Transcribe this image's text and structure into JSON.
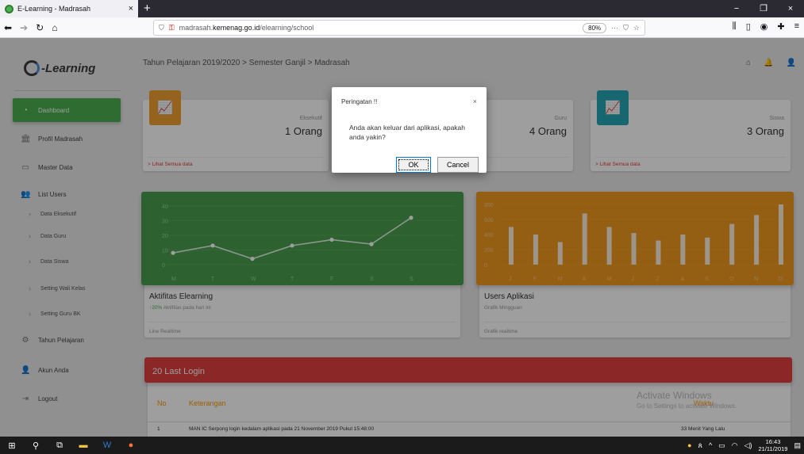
{
  "browser": {
    "tab_title": "E-Learning - Madrasah",
    "tab_close": "×",
    "new_tab": "+",
    "url_plain": "madrasah.",
    "url_domain": "kemenag.go.id",
    "url_path": "/elearning/school",
    "zoom": "80%",
    "win_minimize": "−",
    "win_maximize": "❐",
    "win_close": "×"
  },
  "app": {
    "logo_text": "-Learning",
    "breadcrumb": "Tahun Pelajaran 2019/2020 > Semester Ganjil > Madrasah",
    "menu": [
      {
        "label": "Dashboard",
        "icon": "dashboard-icon"
      },
      {
        "label": "Profil Madrasah",
        "icon": "bank-icon"
      },
      {
        "label": "Master Data",
        "icon": "monitor-icon"
      },
      {
        "label": "List Users",
        "icon": "users-icon"
      },
      {
        "label": "Tahun Pelajaran",
        "icon": "gear-icon"
      },
      {
        "label": "Akun Anda",
        "icon": "user-icon"
      },
      {
        "label": "Logout",
        "icon": "logout-icon"
      }
    ],
    "submenu": [
      {
        "label": "Data Eksekutif"
      },
      {
        "label": "Data Guru"
      },
      {
        "label": "Data Siswa"
      },
      {
        "label": "Setting Wali Kelas"
      },
      {
        "label": "Setting Guru BK"
      }
    ]
  },
  "stats": [
    {
      "label": "Eksekutif",
      "value": "1 Orang",
      "footer": "> Lihat Semua data",
      "color": "#f0a030"
    },
    {
      "label": "Guru",
      "value": "4 Orang",
      "footer": "> Lihat Semua data",
      "color": "#e53935"
    },
    {
      "label": "Siswa",
      "value": "3 Orang",
      "footer": "> Lihat Semua data",
      "color": "#26a6b5"
    }
  ],
  "charts": {
    "line": {
      "title": "Aktifitas Elearning",
      "sub_pct": "20%",
      "sub_text": "Aktifitas pada hari ini",
      "footer": "Line Realtime",
      "bg": "#4a9e4e"
    },
    "bar": {
      "title": "Users Aplikasi",
      "sub_text": "Grafik Mingguan",
      "footer": "Grafik realtime",
      "bg": "#ef9a1e"
    }
  },
  "chart_data": [
    {
      "type": "line",
      "categories": [
        "M",
        "T",
        "W",
        "T",
        "F",
        "S",
        "S"
      ],
      "values": [
        8,
        13,
        4,
        13,
        17,
        14,
        32
      ],
      "ylim": [
        0,
        40
      ],
      "yticks": [
        0,
        10,
        20,
        30,
        40
      ],
      "grid": true
    },
    {
      "type": "bar",
      "categories": [
        "J",
        "F",
        "M",
        "A",
        "M",
        "J",
        "J",
        "A",
        "S",
        "O",
        "N",
        "D"
      ],
      "values": [
        500,
        400,
        300,
        680,
        500,
        420,
        320,
        400,
        360,
        540,
        660,
        800
      ],
      "ylim": [
        0,
        800
      ],
      "yticks": [
        0,
        200,
        400,
        600,
        800
      ],
      "grid": true
    }
  ],
  "last_login": {
    "title": "20 Last Login",
    "columns": [
      "No",
      "Keterangan",
      "Waktu"
    ],
    "rows": [
      {
        "no": "1",
        "ket": "MAN IC Serpong login kedalam aplikasi pada 21 November 2019 Pukul 15:48:00",
        "waktu": "33 Menit Yang Lalu"
      }
    ]
  },
  "watermark": {
    "line1": "Activate Windows",
    "line2": "Go to Settings to activate Windows."
  },
  "modal": {
    "title": "Peringatan !!",
    "close": "×",
    "message": "Anda akan keluar dari aplikasi, apakah anda yakin?",
    "ok": "OK",
    "cancel": "Cancel"
  },
  "taskbar": {
    "time": "16:43",
    "date": "21/11/2019"
  }
}
